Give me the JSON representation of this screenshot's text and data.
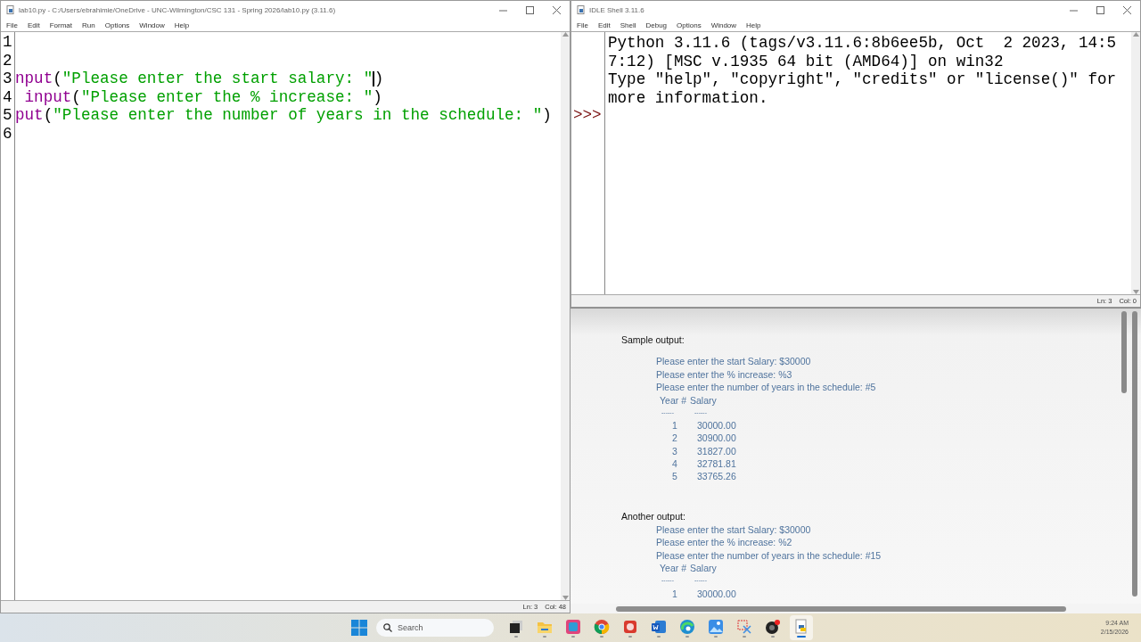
{
  "editor": {
    "title": "lab10.py - C:/Users/ebrahimie/OneDrive - UNC-Wilmington/CSC 131 - Spring 2026/lab10.py (3.11.6)",
    "menu": [
      "File",
      "Edit",
      "Format",
      "Run",
      "Options",
      "Window",
      "Help"
    ],
    "lines": [
      {
        "number": "1"
      },
      {
        "number": "2"
      },
      {
        "number": "3",
        "segments": [
          {
            "kind": "builtin",
            "text": "nput"
          },
          {
            "kind": "plain",
            "text": "("
          },
          {
            "kind": "string",
            "text": "\"Please enter the start salary: \""
          },
          {
            "kind": "cursor"
          },
          {
            "kind": "plain",
            "text": ")"
          }
        ]
      },
      {
        "number": "4",
        "segments": [
          {
            "kind": "builtin",
            "text": " input"
          },
          {
            "kind": "plain",
            "text": "("
          },
          {
            "kind": "string",
            "text": "\"Please enter the % increase: \""
          },
          {
            "kind": "plain",
            "text": ")"
          }
        ]
      },
      {
        "number": "5",
        "segments": [
          {
            "kind": "builtin",
            "text": "put"
          },
          {
            "kind": "plain",
            "text": "("
          },
          {
            "kind": "string",
            "text": "\"Please enter the number of years in the schedule: \""
          },
          {
            "kind": "plain",
            "text": ")"
          }
        ]
      },
      {
        "number": "6"
      }
    ],
    "status": {
      "line": "Ln: 3",
      "col": "Col: 48"
    }
  },
  "shell": {
    "title": "IDLE Shell 3.11.6",
    "menu": [
      "File",
      "Edit",
      "Shell",
      "Debug",
      "Options",
      "Window",
      "Help"
    ],
    "lines": [
      "Python 3.11.6 (tags/v3.11.6:8b6ee5b, Oct  2 2023, 14:5",
      "7:12) [MSC v.1935 64 bit (AMD64)] on win32",
      "Type \"help\", \"copyright\", \"credits\" or \"license()\" for",
      "more information."
    ],
    "prompt": ">>>",
    "status": {
      "line": "Ln: 3",
      "col": "Col: 0"
    }
  },
  "document": {
    "sections": [
      {
        "heading": "Sample output:",
        "prompts": [
          "Please enter the start Salary: $30000",
          "Please enter the % increase: %3",
          "Please enter the number of years in the schedule: #5"
        ],
        "columns": [
          "Year #",
          "Salary"
        ],
        "rules": [
          "------",
          "------"
        ],
        "rows": [
          [
            "1",
            "30000.00"
          ],
          [
            "2",
            "30900.00"
          ],
          [
            "3",
            "31827.00"
          ],
          [
            "4",
            "32781.81"
          ],
          [
            "5",
            "33765.26"
          ]
        ]
      },
      {
        "heading": "Another output:",
        "prompts": [
          "Please enter the start Salary: $30000",
          "Please enter the % increase: %2",
          "Please enter the number of years in the schedule: #15"
        ],
        "columns": [
          "Year #",
          "Salary"
        ],
        "rules": [
          "------",
          "------"
        ],
        "rows": [
          [
            "1",
            "30000.00"
          ]
        ]
      }
    ]
  },
  "taskbar": {
    "search": {
      "placeholder": "Search"
    },
    "apps": [
      {
        "kind": "taskview",
        "selected": false
      },
      {
        "kind": "explorer",
        "selected": false
      },
      {
        "kind": "store",
        "selected": false
      },
      {
        "kind": "chrome",
        "selected": false
      },
      {
        "kind": "pdf",
        "selected": false
      },
      {
        "kind": "word",
        "selected": false
      },
      {
        "kind": "edge",
        "selected": false
      },
      {
        "kind": "photos",
        "selected": false
      },
      {
        "kind": "snip",
        "selected": false
      },
      {
        "kind": "obs",
        "selected": false
      },
      {
        "kind": "python",
        "selected": true
      }
    ],
    "time": "9:24 AM",
    "date": "2/15/2026"
  }
}
